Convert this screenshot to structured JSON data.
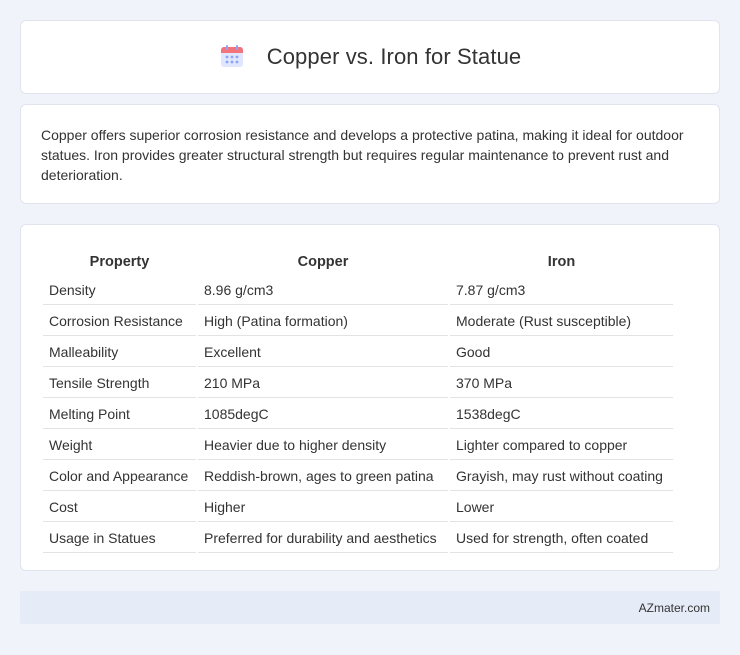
{
  "header": {
    "title": "Copper vs. Iron for Statue",
    "icon": "calendar-icon"
  },
  "description": "Copper offers superior corrosion resistance and develops a protective patina, making it ideal for outdoor statues. Iron provides greater structural strength but requires regular maintenance to prevent rust and deterioration.",
  "table": {
    "headers": [
      "Property",
      "Copper",
      "Iron"
    ],
    "rows": [
      [
        "Density",
        "8.96 g/cm3",
        "7.87 g/cm3"
      ],
      [
        "Corrosion Resistance",
        "High (Patina formation)",
        "Moderate (Rust susceptible)"
      ],
      [
        "Malleability",
        "Excellent",
        "Good"
      ],
      [
        "Tensile Strength",
        "210 MPa",
        "370 MPa"
      ],
      [
        "Melting Point",
        "1085degC",
        "1538degC"
      ],
      [
        "Weight",
        "Heavier due to higher density",
        "Lighter compared to copper"
      ],
      [
        "Color and Appearance",
        "Reddish-brown, ages to green patina",
        "Grayish, may rust without coating"
      ],
      [
        "Cost",
        "Higher",
        "Lower"
      ],
      [
        "Usage in Statues",
        "Preferred for durability and aesthetics",
        "Used for strength, often coated"
      ]
    ]
  },
  "footer": {
    "brand": "AZmater.com"
  },
  "colors": {
    "background": "#f0f3f9",
    "card": "#ffffff",
    "footer": "#e6ecf7",
    "icon_header": "#f2747a",
    "icon_body": "#8fa3f3"
  }
}
